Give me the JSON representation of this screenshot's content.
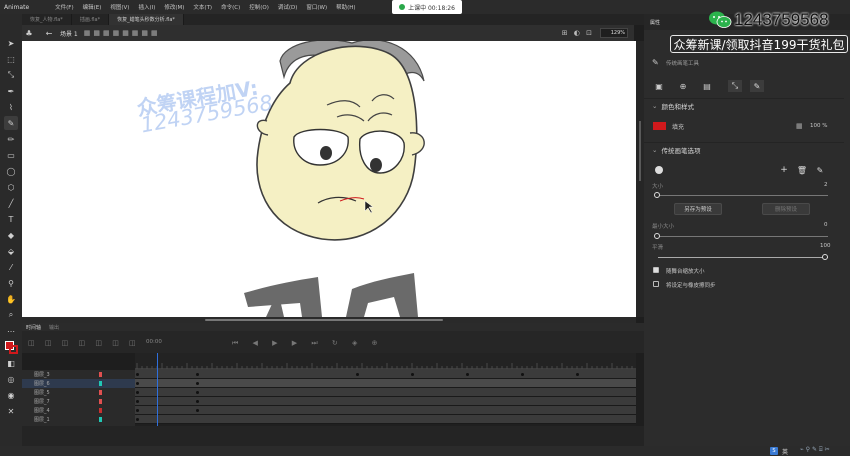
{
  "app": {
    "name": "Animate"
  },
  "menu": [
    "文件(F)",
    "编辑(E)",
    "视图(V)",
    "插入(I)",
    "修改(M)",
    "文本(T)",
    "命令(C)",
    "控制(O)",
    "调试(D)",
    "窗口(W)",
    "帮助(H)"
  ],
  "recording": {
    "label": "上课中 00:18:26"
  },
  "doc_tabs": [
    {
      "label": "恢复_人物.fla*",
      "active": false
    },
    {
      "label": "插画.fla*",
      "active": false
    },
    {
      "label": "恢复_蜡笔头秒数分析.fla*",
      "active": true
    }
  ],
  "scene": {
    "name": "场景 1",
    "zoom": "129%"
  },
  "watermark": {
    "line1": "众筹课程加V:",
    "line2": "1243759568"
  },
  "overlay": {
    "wechat_id": "1243759568",
    "promo": "众筹新课/领取抖音199干货礼包"
  },
  "panel": {
    "tab1": "属性",
    "tool_name": "传统画笔工具",
    "section_color": "颜色和样式",
    "fill_label": "填充",
    "fill_color": "#d0191c",
    "fill_alpha": "100 %",
    "section_brush": "传统画笔选项",
    "size_label": "大小",
    "size_value": "2",
    "save_preset": "另存为预设",
    "delete_preset": "删除预设",
    "min_size_label": "最小大小",
    "min_size_value": "0",
    "smooth_label": "平滑",
    "smooth_value": "100",
    "check1": "随舞台缩放大小",
    "check2": "将设定与橡皮擦同步"
  },
  "timeline": {
    "tabs": [
      "时间轴",
      "输出"
    ],
    "timecode": "00:00",
    "layers": [
      {
        "name": "图层_3",
        "color": "#e05050",
        "selected": false
      },
      {
        "name": "图层_6",
        "color": "#21c7b5",
        "selected": true
      },
      {
        "name": "图层_5",
        "color": "#e05050",
        "selected": false
      },
      {
        "name": "图层_7",
        "color": "#e05050",
        "selected": false
      },
      {
        "name": "图层_4",
        "color": "#c83030",
        "selected": false
      },
      {
        "name": "图层_1",
        "color": "#21c7b5",
        "selected": false
      }
    ]
  },
  "taskbar": {
    "ime": "英"
  }
}
